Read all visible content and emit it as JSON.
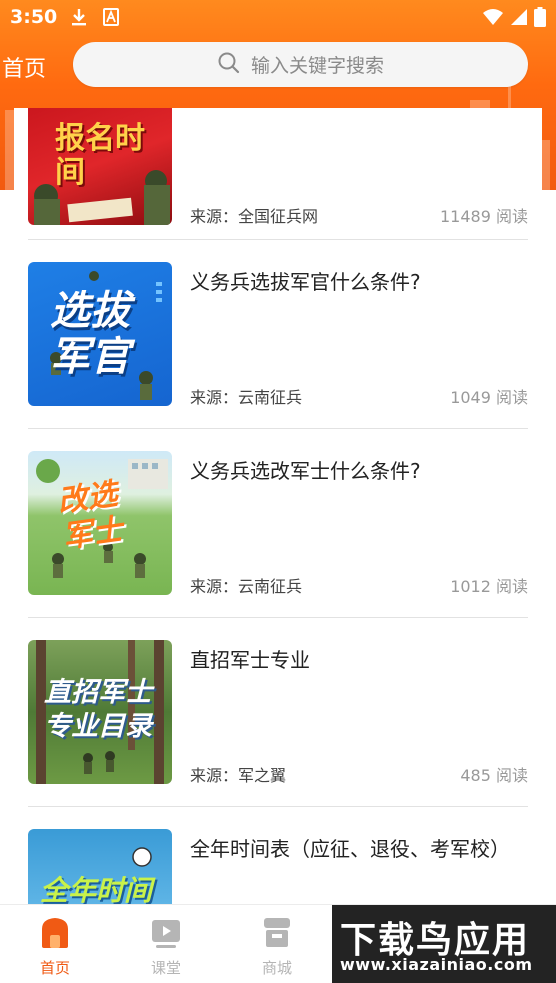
{
  "status_bar": {
    "time": "3:50",
    "icons": [
      "download-icon",
      "font-icon",
      "wifi-icon",
      "signal-icon",
      "battery-icon"
    ]
  },
  "header": {
    "title": "首页",
    "search_placeholder": "输入关键字搜索"
  },
  "articles": [
    {
      "thumb_text": "报名时间",
      "title": "",
      "source": "来源：全国征兵网",
      "reads": "11489 阅读"
    },
    {
      "thumb_text": "选拔军官",
      "title": "义务兵选拔军官什么条件?",
      "source": "来源：云南征兵",
      "reads": "1049 阅读"
    },
    {
      "thumb_text": "改选军士",
      "title": "义务兵选改军士什么条件?",
      "source": "来源：云南征兵",
      "reads": "1012 阅读"
    },
    {
      "thumb_text": "直招军士专业目录",
      "title": "直招军士专业",
      "source": "来源：军之翼",
      "reads": "485 阅读"
    },
    {
      "thumb_text": "全年时间表",
      "title": "全年时间表（应征、退役、考军校）",
      "source": "",
      "reads": ""
    }
  ],
  "tabs": [
    {
      "label": "首页",
      "icon": "home-icon",
      "active": true
    },
    {
      "label": "课堂",
      "icon": "video-icon",
      "active": false
    },
    {
      "label": "商城",
      "icon": "shop-icon",
      "active": false
    }
  ],
  "watermark": {
    "title": "下载鸟应用",
    "url": "www.xiazainiao.com"
  },
  "colors": {
    "accent": "#ff6a10",
    "tab_active": "#f05a14",
    "tab_inactive": "#b5b5b5"
  }
}
